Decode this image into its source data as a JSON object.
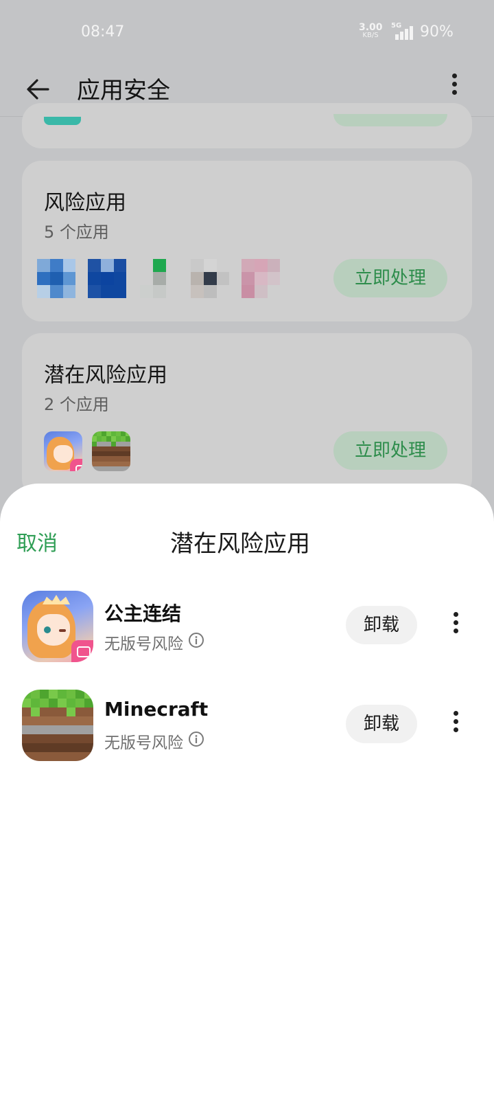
{
  "status_bar": {
    "time": "08:47",
    "net_speed": "3.00",
    "net_unit": "KB/S",
    "signal": "5G",
    "battery": "90%"
  },
  "app_bar": {
    "title": "应用安全"
  },
  "cards": {
    "risk": {
      "title": "风险应用",
      "count": "5 个应用",
      "button": "立即处理"
    },
    "potential": {
      "title": "潜在风险应用",
      "count": "2 个应用",
      "button": "立即处理"
    }
  },
  "sheet": {
    "cancel": "取消",
    "title": "潜在风险应用",
    "apps": [
      {
        "name": "公主连结",
        "risk": "无版号风险",
        "action": "卸载",
        "icon": "princess-connect-icon"
      },
      {
        "name": "Minecraft",
        "risk": "无版号风险",
        "action": "卸载",
        "icon": "minecraft-icon"
      }
    ]
  },
  "colors": {
    "accent_green": "#2f9e55",
    "dim_background": "#c3c4c6",
    "card_dim": "#cfcfcf",
    "button_dim": "#b8cfbd"
  }
}
